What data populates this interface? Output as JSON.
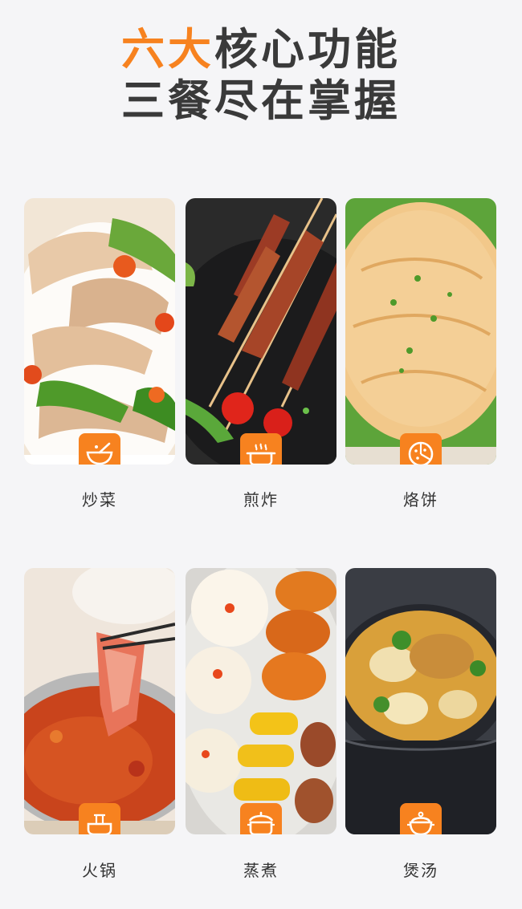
{
  "headline": {
    "accent": "六大",
    "rest": "核心功能",
    "line2": "三餐尽在掌握"
  },
  "colors": {
    "accent": "#f7821f",
    "text": "#333333",
    "background": "#f5f5f7"
  },
  "functions": [
    {
      "label": "炒菜",
      "icon": "wok-icon"
    },
    {
      "label": "煎炸",
      "icon": "fry-pan-icon"
    },
    {
      "label": "烙饼",
      "icon": "pancake-icon"
    },
    {
      "label": "火锅",
      "icon": "hotpot-icon"
    },
    {
      "label": "蒸煮",
      "icon": "steamer-icon"
    },
    {
      "label": "煲汤",
      "icon": "soup-pot-icon"
    }
  ]
}
